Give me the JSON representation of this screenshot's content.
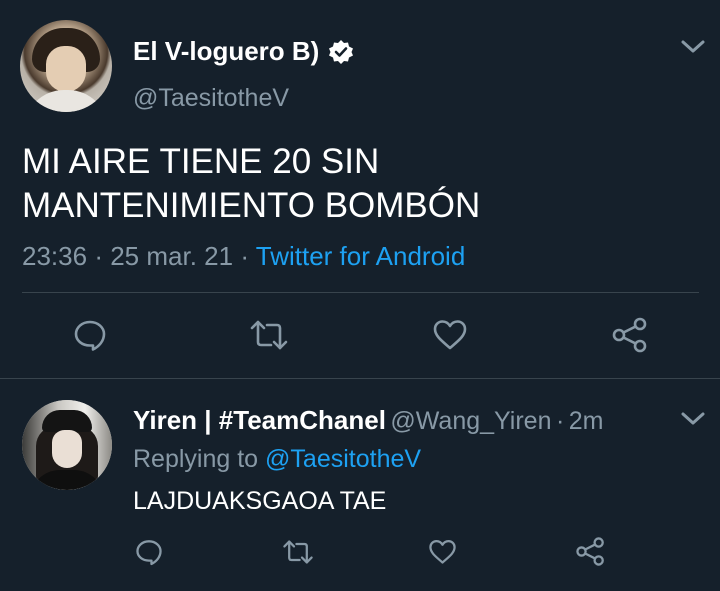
{
  "main_tweet": {
    "display_name": "El V-loguero B)",
    "handle": "@TaesitotheV",
    "text_line1": "MI AIRE TIENE 20 SIN",
    "text_line2": "MANTENIMIENTO BOMBÓN",
    "time": "23:36",
    "sep1": "·",
    "date": "25 mar. 21",
    "sep2": "·",
    "source": "Twitter for Android",
    "icons": [
      "reply-icon",
      "retweet-icon",
      "like-icon",
      "share-icon"
    ]
  },
  "reply_tweet": {
    "display_name": "Yiren | #TeamChanel",
    "handle": "@Wang_Yiren",
    "sep": "·",
    "time_ago": "2m",
    "replying_label": "Replying to",
    "replying_handle": "@TaesitotheV",
    "text": "LAJDUAKSGAOA TAE",
    "icons": [
      "reply-icon",
      "retweet-icon",
      "like-icon",
      "share-icon"
    ]
  },
  "colors": {
    "background": "#15202b",
    "text": "#ffffff",
    "secondary": "#8899a6",
    "link": "#1da1f2",
    "divider": "#38444d"
  }
}
